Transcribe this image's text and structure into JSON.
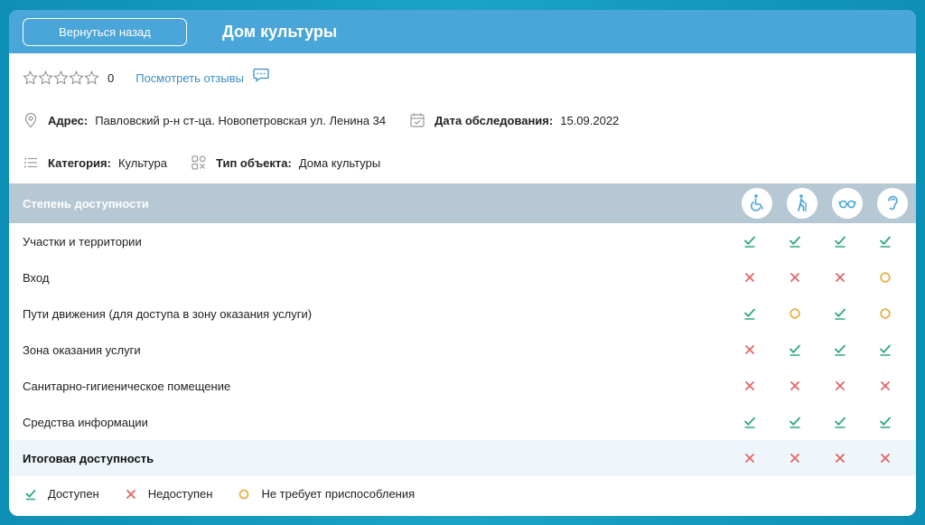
{
  "header": {
    "back_label": "Вернуться назад",
    "title": "Дом культуры"
  },
  "rating": {
    "stars_total": 5,
    "count": "0",
    "reviews_link": "Посмотреть отзывы"
  },
  "info": {
    "address_label": "Адрес:",
    "address_value": "Павловский р-н ст-ца. Новопетровская ул. Ленина 34",
    "date_label": "Дата обследования:",
    "date_value": "15.09.2022",
    "category_label": "Категория:",
    "category_value": "Культура",
    "type_label": "Тип объекта:",
    "type_value": "Дома культуры"
  },
  "table": {
    "header_label": "Степень доступности",
    "columns": [
      "wheelchair-icon",
      "elderly-walking-icon",
      "glasses-icon",
      "ear-icon"
    ],
    "rows": [
      {
        "name": "Участки и территории",
        "statuses": [
          "ok",
          "ok",
          "ok",
          "ok"
        ]
      },
      {
        "name": "Вход",
        "statuses": [
          "no",
          "no",
          "no",
          "na"
        ]
      },
      {
        "name": "Пути движения (для доступа в зону оказания услуги)",
        "statuses": [
          "ok",
          "na",
          "ok",
          "na"
        ]
      },
      {
        "name": "Зона оказания услуги",
        "statuses": [
          "no",
          "ok",
          "ok",
          "ok"
        ]
      },
      {
        "name": "Санитарно-гигиеническое помещение",
        "statuses": [
          "no",
          "no",
          "no",
          "no"
        ]
      },
      {
        "name": "Средства информации",
        "statuses": [
          "ok",
          "ok",
          "ok",
          "ok"
        ]
      }
    ],
    "total": {
      "name": "Итоговая доступность",
      "statuses": [
        "no",
        "no",
        "no",
        "no"
      ]
    }
  },
  "legend": {
    "ok": "Доступен",
    "no": "Недоступен",
    "na": "Не требует приспособления"
  },
  "colors": {
    "header": "#4aa6d8",
    "ok": "#2aa87a",
    "no": "#e06a6a",
    "na": "#e6b24a",
    "table_head": "#b5c8d3"
  }
}
